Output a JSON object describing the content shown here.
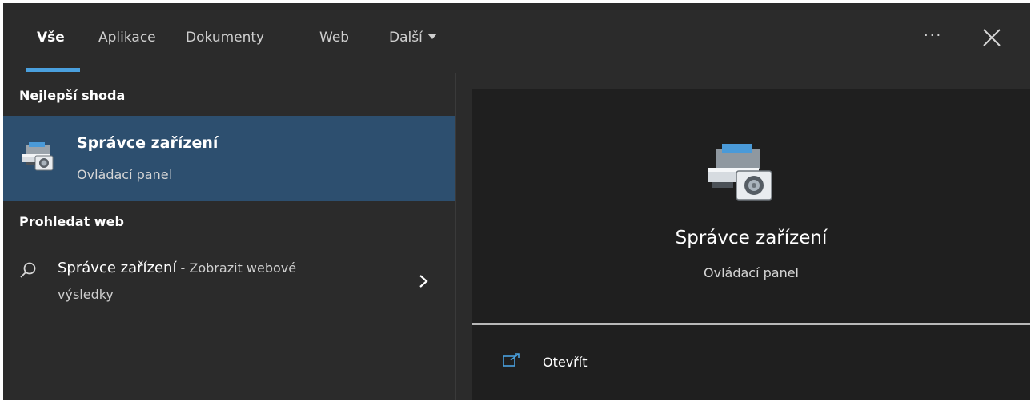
{
  "tabs": [
    {
      "label": "Vše",
      "active": true
    },
    {
      "label": "Aplikace"
    },
    {
      "label": "Dokumenty"
    },
    {
      "label": "Web"
    },
    {
      "label": "Další"
    }
  ],
  "header": {
    "more_label": "···",
    "accent_color": "#4aa0de"
  },
  "left": {
    "best_match_title": "Nejlepší shoda",
    "best_match": {
      "title": "Správce zařízení",
      "subtitle": "Ovládací panel",
      "icon": "device-manager-icon"
    },
    "web_title": "Prohledat web",
    "web_result": {
      "query": "Správce zařízení",
      "suffix": " - Zobrazit webové",
      "line2": "výsledky"
    }
  },
  "detail": {
    "title": "Správce zařízení",
    "subtitle": "Ovládací panel",
    "action_open": "Otevřít"
  }
}
